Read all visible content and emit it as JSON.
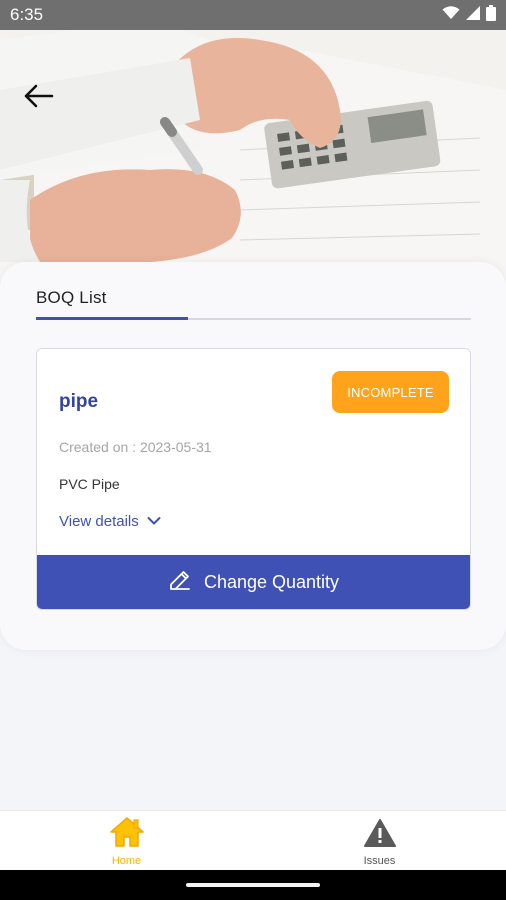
{
  "status_bar": {
    "time": "6:35",
    "icons": [
      "wifi-icon",
      "signal-icon",
      "battery-icon"
    ]
  },
  "header": {
    "back_icon": "back-arrow-icon",
    "hero_image": "calculator-hands-photo"
  },
  "tabs": [
    {
      "label": "BOQ List",
      "active": true
    }
  ],
  "boq_items": [
    {
      "name": "pipe",
      "status": "INCOMPLETE",
      "created_label": "Created on : 2023-05-31",
      "description": "PVC Pipe",
      "view_details_label": "View details",
      "action_label": "Change Quantity",
      "action_icon": "pencil-icon"
    }
  ],
  "bottom_nav": [
    {
      "label": "Home",
      "icon": "home-icon",
      "active": true
    },
    {
      "label": "Issues",
      "icon": "warning-icon",
      "active": false
    }
  ],
  "colors": {
    "primary": "#3f51b5",
    "badge": "#ffa31a",
    "active_nav": "#ffb400",
    "status_bar": "#6f6f6f"
  }
}
